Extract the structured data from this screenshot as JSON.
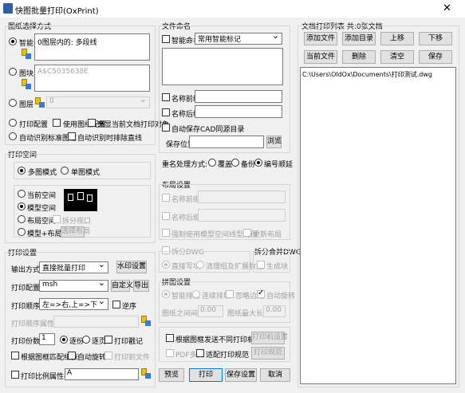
{
  "window": {
    "title": "快图批量打印(OxPrint)",
    "close": "✕"
  },
  "drawing_selection": {
    "title": "图纸选择方式",
    "smart": {
      "label": "智能",
      "text": "0图层内的: 多段线"
    },
    "block": {
      "label": "图块",
      "text": "A$C5035638E"
    },
    "layer": {
      "label": "图层",
      "value": "0"
    },
    "options": [
      "打印配置",
      "使用图纸配置",
      "亮显当前文档打印对象",
      "自动识别标准图框",
      "自动识别时排除直线"
    ]
  },
  "print_space": {
    "title": "打印空间",
    "mode_multi": "多图模式",
    "mode_single": "单图模式",
    "spaces": [
      "当前空间",
      "模型空间",
      "布局空间",
      "模型+布局"
    ],
    "split_viewport": "拆分视口",
    "select_layout": "选择布局"
  },
  "print_settings": {
    "title": "打印设置",
    "output_label": "输出方式",
    "output_value": "直接批量打印",
    "watermark": "水印设置",
    "config_label": "打印配置",
    "config_value": "msh",
    "custom": "自定义",
    "export": "导出",
    "order_label": "打印顺序",
    "order_value": "左=>右,上=>下",
    "reverse": "逆序",
    "order_attr_label": "打印顺序属性",
    "copies_label": "打印份数",
    "copies_value": "1",
    "by_copy": "逐份",
    "by_page": "逐页",
    "stamp": "打印戳记",
    "match_paper": "根据图框匹配纸张",
    "auto_rotate": "自动旋转",
    "print_to_file": "打印到文件",
    "scale_attr": "打印比例属性名",
    "scale_attr_value": "A"
  },
  "file_naming": {
    "title": "文件命名",
    "smart_naming": "智能命名",
    "smart_value": "常用智能标记",
    "prefix": "名称前缀",
    "suffix": "名称后缀",
    "auto_save": "自动保存CAD同源目录",
    "save_loc": "保存位置",
    "browse": "浏览"
  },
  "rename": {
    "label": "重名处理方式:",
    "options": [
      "覆盖",
      "备份",
      "编号顺延"
    ]
  },
  "layout_settings": {
    "title": "布局设置",
    "prefix": "名称前缀",
    "suffix": "名称后缀",
    "force_scale": "强制使用模型空间线型比例",
    "update_layout": "更新布局"
  },
  "split_dwg": {
    "title": "拆分DWG",
    "direct": "直接写块",
    "clean": "清理组及扩展数据"
  },
  "merge_dwg": {
    "title": "拆分合并DWG",
    "gen_block": "生成块"
  },
  "arrange": {
    "title": "拼图设置",
    "smart": "智能排版",
    "continuous": "连续排版",
    "ignore_margin": "忽略边距",
    "auto_rotate": "自动旋转",
    "spacing": "图纸之间间距",
    "spacing_val": "0.00",
    "max_len": "图纸最大长度",
    "max_len_val": "0.00"
  },
  "send": {
    "by_size": "根据图框发送不同打印机",
    "printer_settings": "打印机设置",
    "pdf_multi": "PDF多页",
    "fit_printer": "适配打印规范",
    "print_spec": "打印规范"
  },
  "actions": {
    "preview": "预览",
    "print": "打印",
    "save": "保存设置",
    "cancel": "取消"
  },
  "doc_list": {
    "title": "文档打印列表 共:0张文档",
    "buttons": [
      "添加文件",
      "添加目录",
      "上移",
      "下移",
      "当前文件",
      "删除",
      "清空",
      "保存"
    ],
    "items": [
      "C:\\Users\\OldOx\\Documents\\打印测试.dwg"
    ]
  }
}
